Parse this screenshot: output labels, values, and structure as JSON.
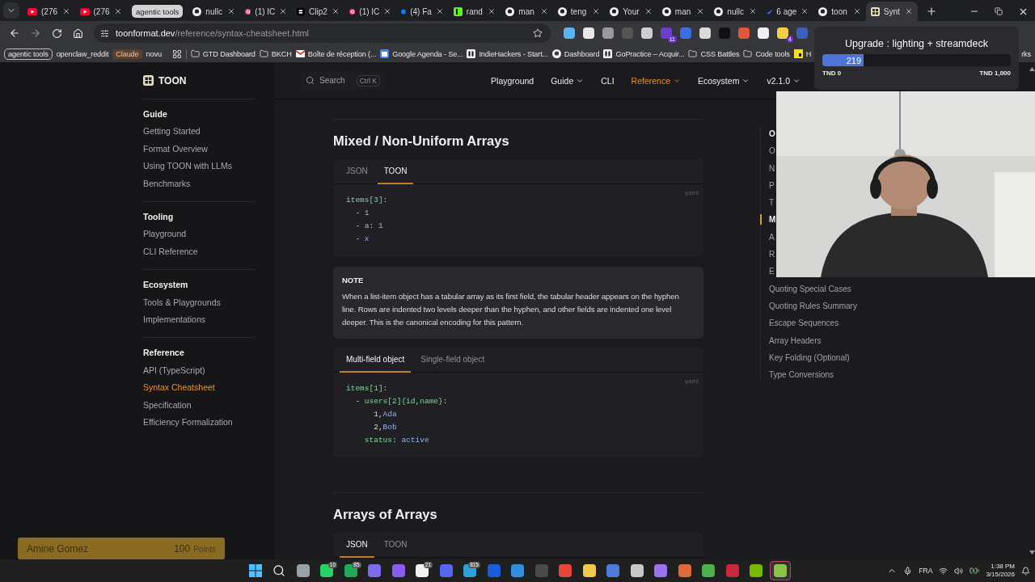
{
  "browser": {
    "tabs": [
      {
        "kind": "video",
        "title": "(276",
        "selected": false
      },
      {
        "kind": "video",
        "title": "(276",
        "selected": false
      },
      {
        "kind": "group",
        "title": "agentic tools",
        "selected": false
      },
      {
        "kind": "github",
        "title": "nullc",
        "selected": false
      },
      {
        "kind": "target",
        "title": "(1) IC",
        "selected": false
      },
      {
        "kind": "clip",
        "title": "Clip2",
        "selected": false
      },
      {
        "kind": "target",
        "title": "(1) IC",
        "selected": false
      },
      {
        "kind": "facebook",
        "title": "(4) Fa",
        "selected": false
      },
      {
        "kind": "k",
        "title": "rand",
        "selected": false
      },
      {
        "kind": "github",
        "title": "man",
        "selected": false
      },
      {
        "kind": "github",
        "title": "teng",
        "selected": false
      },
      {
        "kind": "github",
        "title": "Your",
        "selected": false
      },
      {
        "kind": "github",
        "title": "man",
        "selected": false
      },
      {
        "kind": "github",
        "title": "nullc",
        "selected": false
      },
      {
        "kind": "bird",
        "title": "6 age",
        "selected": false
      },
      {
        "kind": "github",
        "title": "toon",
        "selected": false
      },
      {
        "kind": "grid",
        "title": "Synt",
        "selected": true
      }
    ],
    "url_host": "toonformat.dev",
    "url_path": "/reference/syntax-cheatsheet.html",
    "extensions": [
      {
        "color": "#5ab4f0"
      },
      {
        "color": "#e8e8e8"
      },
      {
        "color": "#9a9a9a"
      },
      {
        "color": "#555555"
      },
      {
        "color": "#cfcfcf"
      },
      {
        "color": "#6a3fc9",
        "badge": "11"
      },
      {
        "color": "#3b6fe0"
      },
      {
        "color": "#d9d9d9"
      },
      {
        "color": "#111111"
      },
      {
        "color": "#e0583a"
      },
      {
        "color": "#f0f0f0"
      },
      {
        "color": "#f2d04a",
        "badge": "4"
      },
      {
        "color": "#3e5fb8"
      }
    ],
    "bookmarks": [
      {
        "kind": "chip",
        "label": "agentic tools"
      },
      {
        "kind": "plain",
        "label": "openclaw_reddit"
      },
      {
        "kind": "tag",
        "label": "Claude"
      },
      {
        "kind": "plain",
        "label": "novu"
      },
      {
        "kind": "apps"
      },
      {
        "kind": "folder",
        "label": "GTD Dashboard"
      },
      {
        "kind": "folder",
        "label": "BKCH"
      },
      {
        "kind": "mail",
        "label": "Boîte de réception (..."
      },
      {
        "kind": "calendar",
        "label": "Google Agenda - Se..."
      },
      {
        "kind": "site",
        "label": "IndieHackers - Start..."
      },
      {
        "kind": "github",
        "label": "Dashboard"
      },
      {
        "kind": "site",
        "label": "GoPractice – Acquir..."
      },
      {
        "kind": "folder",
        "label": "CSS Battles"
      },
      {
        "kind": "folder",
        "label": "Code tools"
      },
      {
        "kind": "js",
        "label": "H"
      }
    ],
    "bookmarks_overflow": "rks"
  },
  "site": {
    "logo": "TOON",
    "search": {
      "placeholder": "Search",
      "shortcut": "Ctrl K"
    },
    "nav": [
      {
        "label": "Playground",
        "dropdown": false,
        "selected": false
      },
      {
        "label": "Guide",
        "dropdown": true,
        "selected": false
      },
      {
        "label": "CLI",
        "dropdown": false,
        "selected": false
      },
      {
        "label": "Reference",
        "dropdown": true,
        "selected": true
      },
      {
        "label": "Ecosystem",
        "dropdown": true,
        "selected": false
      },
      {
        "label": "v2.1.0",
        "dropdown": true,
        "selected": false
      }
    ],
    "sidebar": [
      {
        "title": "Guide",
        "items": [
          {
            "label": "Getting Started",
            "selected": false
          },
          {
            "label": "Format Overview",
            "selected": false
          },
          {
            "label": "Using TOON with LLMs",
            "selected": false
          },
          {
            "label": "Benchmarks",
            "selected": false
          }
        ]
      },
      {
        "title": "Tooling",
        "items": [
          {
            "label": "Playground",
            "selected": false
          },
          {
            "label": "CLI Reference",
            "selected": false
          }
        ]
      },
      {
        "title": "Ecosystem",
        "items": [
          {
            "label": "Tools & Playgrounds",
            "selected": false
          },
          {
            "label": "Implementations",
            "selected": false
          }
        ]
      },
      {
        "title": "Reference",
        "items": [
          {
            "label": "API (TypeScript)",
            "selected": false
          },
          {
            "label": "Syntax Cheatsheet",
            "selected": true
          },
          {
            "label": "Specification",
            "selected": false
          },
          {
            "label": "Efficiency Formalization",
            "selected": false
          }
        ]
      }
    ],
    "article": [
      {
        "kind": "heading",
        "text": "Mixed / Non-Uniform Arrays"
      },
      {
        "kind": "code",
        "tabs": [
          {
            "label": "JSON",
            "selected": false
          },
          {
            "label": "TOON",
            "selected": true
          }
        ],
        "lang": "yaml",
        "lines": [
          [
            {
              "kind": "key",
              "text": "items[3]"
            },
            {
              "kind": "punct",
              "text": ":"
            }
          ],
          [
            {
              "kind": "punct",
              "text": "  - "
            },
            {
              "kind": "value",
              "text": "1"
            }
          ],
          [
            {
              "kind": "punct",
              "text": "  - "
            },
            {
              "kind": "key",
              "text": "a"
            },
            {
              "kind": "punct",
              "text": ": "
            },
            {
              "kind": "value",
              "text": "1"
            }
          ],
          [
            {
              "kind": "punct",
              "text": "  - "
            },
            {
              "kind": "value",
              "text": "x"
            }
          ]
        ]
      },
      {
        "kind": "note",
        "title": "NOTE",
        "text": "When a list-item object has a tabular array as its first field, the tabular header appears on the hyphen line. Rows are indented two levels deeper than the hyphen, and other fields are indented one level deeper. This is the canonical encoding for this pattern."
      },
      {
        "kind": "code",
        "tabs": [
          {
            "label": "Multi-field object",
            "selected": true
          },
          {
            "label": "Single-field object",
            "selected": false
          }
        ],
        "lang": "yaml",
        "lines": [
          [
            {
              "kind": "key",
              "text": "items[1]"
            },
            {
              "kind": "punct",
              "text": ":"
            }
          ],
          [
            {
              "kind": "punct",
              "text": "  - "
            },
            {
              "kind": "key",
              "text": "users[2]{id,name}"
            },
            {
              "kind": "punct",
              "text": ":"
            }
          ],
          [
            {
              "kind": "punct",
              "text": "      1,"
            },
            {
              "kind": "value",
              "text": "Ada"
            }
          ],
          [
            {
              "kind": "punct",
              "text": "      2,"
            },
            {
              "kind": "value",
              "text": "Bob"
            }
          ],
          [
            {
              "kind": "key",
              "text": "    status"
            },
            {
              "kind": "punct",
              "text": ": "
            },
            {
              "kind": "value",
              "text": "active"
            }
          ]
        ]
      },
      {
        "kind": "heading",
        "text": "Arrays of Arrays"
      },
      {
        "kind": "code",
        "tabs": [
          {
            "label": "JSON",
            "selected": true
          },
          {
            "label": "TOON",
            "selected": false
          }
        ]
      }
    ],
    "toc": {
      "title": "O",
      "items": [
        {
          "label": "O",
          "selected": false
        },
        {
          "label": "N",
          "selected": false
        },
        {
          "label": "P",
          "selected": false
        },
        {
          "label": "T",
          "selected": false
        },
        {
          "label": "M",
          "selected": true
        },
        {
          "label": "A",
          "selected": false
        },
        {
          "label": "R",
          "selected": false
        },
        {
          "label": "E",
          "selected": false
        },
        {
          "label": "Quoting Special Cases",
          "selected": false
        },
        {
          "label": "Quoting Rules Summary",
          "selected": false
        },
        {
          "label": "Escape Sequences",
          "selected": false
        },
        {
          "label": "Array Headers",
          "selected": false
        },
        {
          "label": "Key Folding (Optional)",
          "selected": false
        },
        {
          "label": "Type Conversions",
          "selected": false
        }
      ]
    }
  },
  "donation": {
    "title": "Upgrade : lighting + streamdeck",
    "level": 0.219,
    "amount": "219",
    "min": "TND 0",
    "max": "TND 1,000"
  },
  "points_badge": {
    "name": "Amine Gomez",
    "points": "100",
    "unit": "Points"
  },
  "taskbar": {
    "apps": [
      {
        "kind": "start",
        "selected": false
      },
      {
        "kind": "search",
        "selected": false
      },
      {
        "kind": "app",
        "color": "#9aa0a6",
        "selected": false
      },
      {
        "kind": "app",
        "color": "#25d366",
        "badge": "10",
        "selected": false
      },
      {
        "kind": "app",
        "color": "#1faa55",
        "badge": "85",
        "selected": false
      },
      {
        "kind": "app",
        "color": "#7b6cf0",
        "selected": false
      },
      {
        "kind": "app",
        "color": "#8a5cf0",
        "selected": false
      },
      {
        "kind": "app",
        "color": "#f2f2f2",
        "badge": "21",
        "selected": false
      },
      {
        "kind": "app",
        "color": "#5865f2",
        "selected": false
      },
      {
        "kind": "app",
        "color": "#2aa1da",
        "badge": "815",
        "selected": false
      },
      {
        "kind": "app",
        "color": "#175ddc",
        "selected": false
      },
      {
        "kind": "app",
        "color": "#2f8fe0",
        "selected": false
      },
      {
        "kind": "app",
        "color": "#4a4a4a",
        "selected": false
      },
      {
        "kind": "app",
        "color": "#e8453c",
        "selected": false
      },
      {
        "kind": "app",
        "color": "#f2c94c",
        "selected": false
      },
      {
        "kind": "app",
        "color": "#4c7bd9",
        "selected": false
      },
      {
        "kind": "app",
        "color": "#c8c8c8",
        "selected": false
      },
      {
        "kind": "app",
        "color": "#9a74ee",
        "selected": false
      },
      {
        "kind": "app",
        "color": "#e06b3a",
        "selected": false
      },
      {
        "kind": "app",
        "color": "#4caf50",
        "selected": false
      },
      {
        "kind": "app",
        "color": "#c7283f",
        "selected": false
      },
      {
        "kind": "app",
        "color": "#76b900",
        "selected": false
      },
      {
        "kind": "app",
        "color": "#8bc34a",
        "selected": true
      }
    ],
    "language": "FRA",
    "time": "1:38 PM",
    "date": "3/15/2026"
  }
}
